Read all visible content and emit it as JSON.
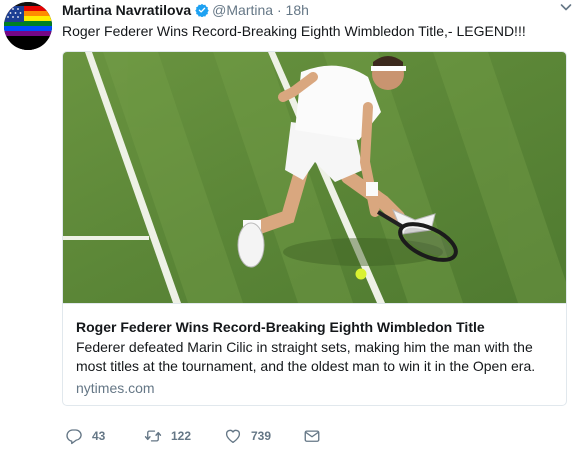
{
  "tweet": {
    "display_name": "Martina Navratilova",
    "handle": "@Martina",
    "separator": "·",
    "time": "18h",
    "text": "Roger Federer Wins Record-Breaking Eighth Wimbledon Title,- LEGEND!!!",
    "verified": true,
    "avatar_text": "It's Not Our Bl"
  },
  "card": {
    "title": "Roger Federer Wins Record-Breaking Eighth Wimbledon Title",
    "description": "Federer defeated Marin Cilic in straight sets, making him the man with the most titles at the tournament, and the oldest man to win it in the Open era.",
    "domain": "nytimes.com"
  },
  "actions": {
    "reply_count": "43",
    "retweet_count": "122",
    "like_count": "739"
  },
  "colors": {
    "accent": "#1da1f2",
    "secondary_text": "#657786",
    "court_green": "#5f8a3a"
  },
  "icons": [
    "verified-badge-icon",
    "chevron-down-icon",
    "reply-icon",
    "retweet-icon",
    "like-icon",
    "direct-message-icon"
  ]
}
